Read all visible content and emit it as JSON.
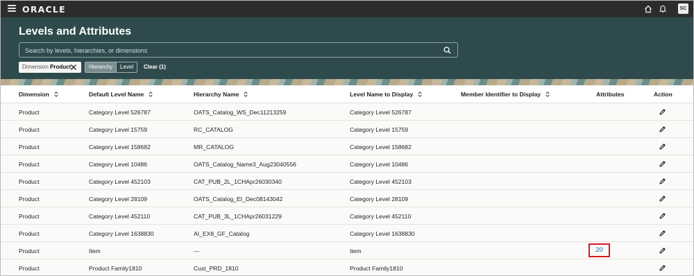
{
  "topbar": {
    "brand": "ORACLE",
    "avatar_initials": "SC",
    "icons": [
      "menu-icon",
      "home-icon",
      "bell-icon"
    ]
  },
  "header": {
    "title": "Levels and Attributes",
    "search_placeholder": "Search by levels, hierarchies, or dimensions",
    "chips": {
      "dimension_label": "Dimension",
      "dimension_value": "Product",
      "hierarchy": "Hierarchy",
      "level": "Level",
      "clear": "Clear (1)"
    }
  },
  "table": {
    "columns": [
      "Dimension",
      "Default Level Name",
      "Hierarchy Name",
      "Level Name to Display",
      "Member Identifier to Display",
      "Attributes",
      "Action"
    ],
    "rows": [
      {
        "dimension": "Product",
        "default_level": "Category Level 526787",
        "hierarchy": "OATS_Catalog_WS_Dec11213259",
        "level_display": "Category Level 526787",
        "member_id": "",
        "attributes": ""
      },
      {
        "dimension": "Product",
        "default_level": "Category Level 15759",
        "hierarchy": "RC_CATALOG",
        "level_display": "Category Level 15759",
        "member_id": "",
        "attributes": ""
      },
      {
        "dimension": "Product",
        "default_level": "Category Level 158682",
        "hierarchy": "MR_CATALOG",
        "level_display": "Category Level 158682",
        "member_id": "",
        "attributes": ""
      },
      {
        "dimension": "Product",
        "default_level": "Category Level 10486",
        "hierarchy": "OATS_Catalog_Name3_Aug23040556",
        "level_display": "Category Level 10486",
        "member_id": "",
        "attributes": ""
      },
      {
        "dimension": "Product",
        "default_level": "Category Level 452103",
        "hierarchy": "CAT_PUB_2L_1CHApr26030340",
        "level_display": "Category Level 452103",
        "member_id": "",
        "attributes": ""
      },
      {
        "dimension": "Product",
        "default_level": "Category Level 28109",
        "hierarchy": "OATS_Catalog_EI_Dec08143042",
        "level_display": "Category Level 28109",
        "member_id": "",
        "attributes": ""
      },
      {
        "dimension": "Product",
        "default_level": "Category Level 452110",
        "hierarchy": "CAT_PUB_3L_1CHApr26031229",
        "level_display": "Category Level 452110",
        "member_id": "",
        "attributes": ""
      },
      {
        "dimension": "Product",
        "default_level": "Category Level 1638830",
        "hierarchy": "AI_EX8_GF_Catalog",
        "level_display": "Category Level 1638830",
        "member_id": "",
        "attributes": ""
      },
      {
        "dimension": "Product",
        "default_level": "Item",
        "hierarchy": "---",
        "level_display": "Item",
        "member_id": "",
        "attributes": "20"
      },
      {
        "dimension": "Product",
        "default_level": "Product Family1810",
        "hierarchy": "Cust_PRD_1810",
        "level_display": "Product Family1810",
        "member_id": "",
        "attributes": ""
      }
    ]
  },
  "colors": {
    "header_bg": "#2e4a4d",
    "topbar_bg": "#2c2c2c",
    "link": "#1a63a8",
    "highlight_border": "#d9171f"
  }
}
